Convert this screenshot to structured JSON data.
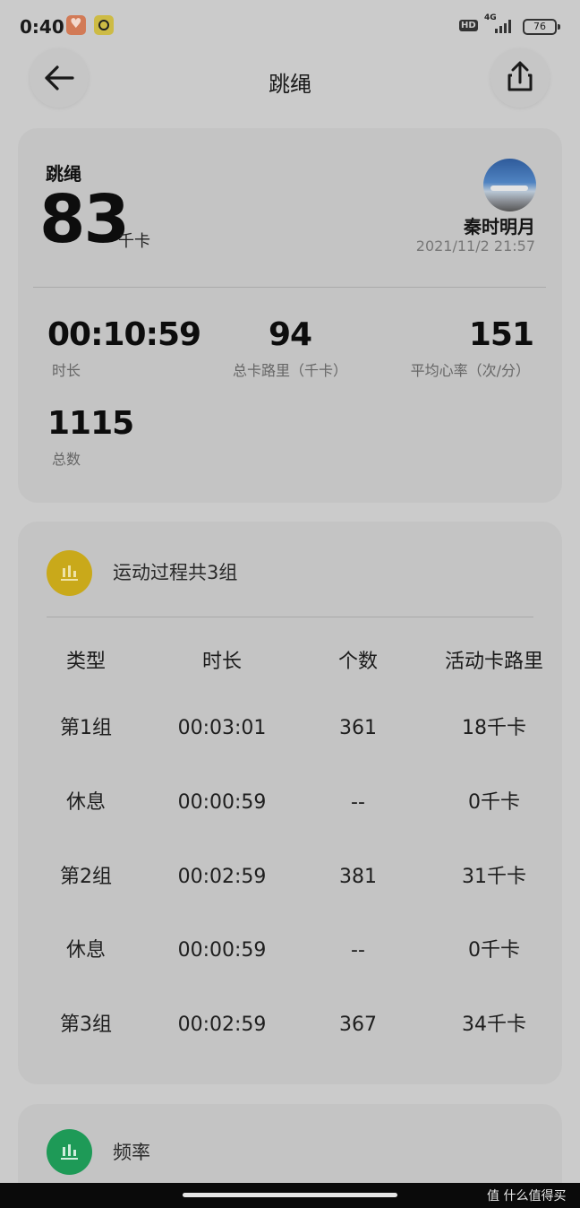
{
  "status_bar": {
    "time": "0:40",
    "hd": "HD",
    "network": "4G",
    "battery": "76"
  },
  "header": {
    "title": "跳绳",
    "back_icon": "arrow-left-icon",
    "share_icon": "share-upload-icon"
  },
  "summary": {
    "label": "跳绳",
    "value": "83",
    "unit": "千卡",
    "user_name": "秦时明月",
    "datetime": "2021/11/2 21:57",
    "stats": [
      {
        "value": "00:10:59",
        "label": "时长"
      },
      {
        "value": "94",
        "label": "总卡路里（千卡）"
      },
      {
        "value": "151",
        "label": "平均心率（次/分）"
      },
      {
        "value": "1115",
        "label": "总数"
      }
    ]
  },
  "process": {
    "icon": "bar-chart-icon",
    "title": "运动过程共3组",
    "headers": [
      "类型",
      "时长",
      "个数",
      "活动卡路里"
    ],
    "rows": [
      [
        "第1组",
        "00:03:01",
        "361",
        "18千卡"
      ],
      [
        "休息",
        "00:00:59",
        "--",
        "0千卡"
      ],
      [
        "第2组",
        "00:02:59",
        "381",
        "31千卡"
      ],
      [
        "休息",
        "00:00:59",
        "--",
        "0千卡"
      ],
      [
        "第3组",
        "00:02:59",
        "367",
        "34千卡"
      ]
    ]
  },
  "frequency": {
    "icon": "bar-chart-icon",
    "title": "频率"
  },
  "watermark": "值 什么值得买",
  "colors": {
    "background": "#cbcbcb",
    "card": "#c4c4c4",
    "process_icon": "#c9a91a",
    "frequency_icon": "#1e9a57"
  }
}
